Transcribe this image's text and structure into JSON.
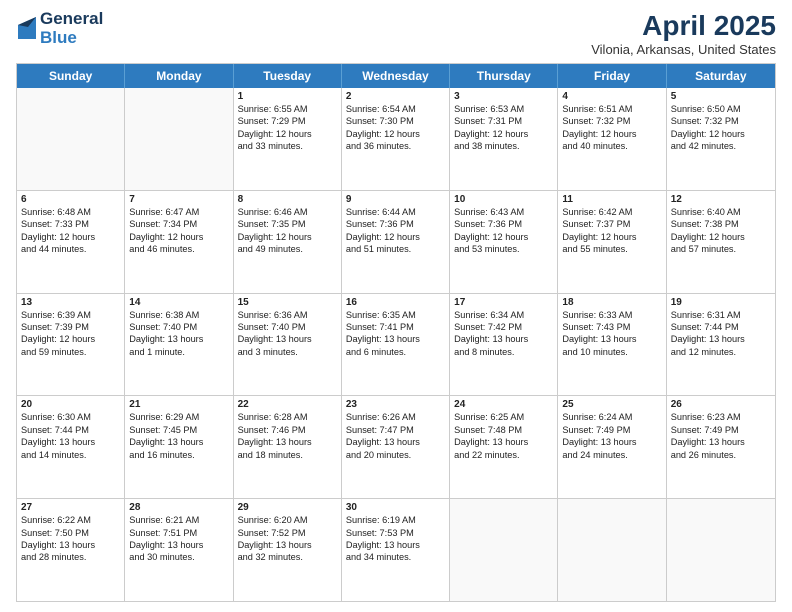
{
  "logo": {
    "general": "General",
    "blue": "Blue"
  },
  "title": "April 2025",
  "location": "Vilonia, Arkansas, United States",
  "days_of_week": [
    "Sunday",
    "Monday",
    "Tuesday",
    "Wednesday",
    "Thursday",
    "Friday",
    "Saturday"
  ],
  "weeks": [
    [
      {
        "day": null,
        "info": null
      },
      {
        "day": null,
        "info": null
      },
      {
        "day": "1",
        "info": "Sunrise: 6:55 AM\nSunset: 7:29 PM\nDaylight: 12 hours\nand 33 minutes."
      },
      {
        "day": "2",
        "info": "Sunrise: 6:54 AM\nSunset: 7:30 PM\nDaylight: 12 hours\nand 36 minutes."
      },
      {
        "day": "3",
        "info": "Sunrise: 6:53 AM\nSunset: 7:31 PM\nDaylight: 12 hours\nand 38 minutes."
      },
      {
        "day": "4",
        "info": "Sunrise: 6:51 AM\nSunset: 7:32 PM\nDaylight: 12 hours\nand 40 minutes."
      },
      {
        "day": "5",
        "info": "Sunrise: 6:50 AM\nSunset: 7:32 PM\nDaylight: 12 hours\nand 42 minutes."
      }
    ],
    [
      {
        "day": "6",
        "info": "Sunrise: 6:48 AM\nSunset: 7:33 PM\nDaylight: 12 hours\nand 44 minutes."
      },
      {
        "day": "7",
        "info": "Sunrise: 6:47 AM\nSunset: 7:34 PM\nDaylight: 12 hours\nand 46 minutes."
      },
      {
        "day": "8",
        "info": "Sunrise: 6:46 AM\nSunset: 7:35 PM\nDaylight: 12 hours\nand 49 minutes."
      },
      {
        "day": "9",
        "info": "Sunrise: 6:44 AM\nSunset: 7:36 PM\nDaylight: 12 hours\nand 51 minutes."
      },
      {
        "day": "10",
        "info": "Sunrise: 6:43 AM\nSunset: 7:36 PM\nDaylight: 12 hours\nand 53 minutes."
      },
      {
        "day": "11",
        "info": "Sunrise: 6:42 AM\nSunset: 7:37 PM\nDaylight: 12 hours\nand 55 minutes."
      },
      {
        "day": "12",
        "info": "Sunrise: 6:40 AM\nSunset: 7:38 PM\nDaylight: 12 hours\nand 57 minutes."
      }
    ],
    [
      {
        "day": "13",
        "info": "Sunrise: 6:39 AM\nSunset: 7:39 PM\nDaylight: 12 hours\nand 59 minutes."
      },
      {
        "day": "14",
        "info": "Sunrise: 6:38 AM\nSunset: 7:40 PM\nDaylight: 13 hours\nand 1 minute."
      },
      {
        "day": "15",
        "info": "Sunrise: 6:36 AM\nSunset: 7:40 PM\nDaylight: 13 hours\nand 3 minutes."
      },
      {
        "day": "16",
        "info": "Sunrise: 6:35 AM\nSunset: 7:41 PM\nDaylight: 13 hours\nand 6 minutes."
      },
      {
        "day": "17",
        "info": "Sunrise: 6:34 AM\nSunset: 7:42 PM\nDaylight: 13 hours\nand 8 minutes."
      },
      {
        "day": "18",
        "info": "Sunrise: 6:33 AM\nSunset: 7:43 PM\nDaylight: 13 hours\nand 10 minutes."
      },
      {
        "day": "19",
        "info": "Sunrise: 6:31 AM\nSunset: 7:44 PM\nDaylight: 13 hours\nand 12 minutes."
      }
    ],
    [
      {
        "day": "20",
        "info": "Sunrise: 6:30 AM\nSunset: 7:44 PM\nDaylight: 13 hours\nand 14 minutes."
      },
      {
        "day": "21",
        "info": "Sunrise: 6:29 AM\nSunset: 7:45 PM\nDaylight: 13 hours\nand 16 minutes."
      },
      {
        "day": "22",
        "info": "Sunrise: 6:28 AM\nSunset: 7:46 PM\nDaylight: 13 hours\nand 18 minutes."
      },
      {
        "day": "23",
        "info": "Sunrise: 6:26 AM\nSunset: 7:47 PM\nDaylight: 13 hours\nand 20 minutes."
      },
      {
        "day": "24",
        "info": "Sunrise: 6:25 AM\nSunset: 7:48 PM\nDaylight: 13 hours\nand 22 minutes."
      },
      {
        "day": "25",
        "info": "Sunrise: 6:24 AM\nSunset: 7:49 PM\nDaylight: 13 hours\nand 24 minutes."
      },
      {
        "day": "26",
        "info": "Sunrise: 6:23 AM\nSunset: 7:49 PM\nDaylight: 13 hours\nand 26 minutes."
      }
    ],
    [
      {
        "day": "27",
        "info": "Sunrise: 6:22 AM\nSunset: 7:50 PM\nDaylight: 13 hours\nand 28 minutes."
      },
      {
        "day": "28",
        "info": "Sunrise: 6:21 AM\nSunset: 7:51 PM\nDaylight: 13 hours\nand 30 minutes."
      },
      {
        "day": "29",
        "info": "Sunrise: 6:20 AM\nSunset: 7:52 PM\nDaylight: 13 hours\nand 32 minutes."
      },
      {
        "day": "30",
        "info": "Sunrise: 6:19 AM\nSunset: 7:53 PM\nDaylight: 13 hours\nand 34 minutes."
      },
      {
        "day": null,
        "info": null
      },
      {
        "day": null,
        "info": null
      },
      {
        "day": null,
        "info": null
      }
    ]
  ]
}
